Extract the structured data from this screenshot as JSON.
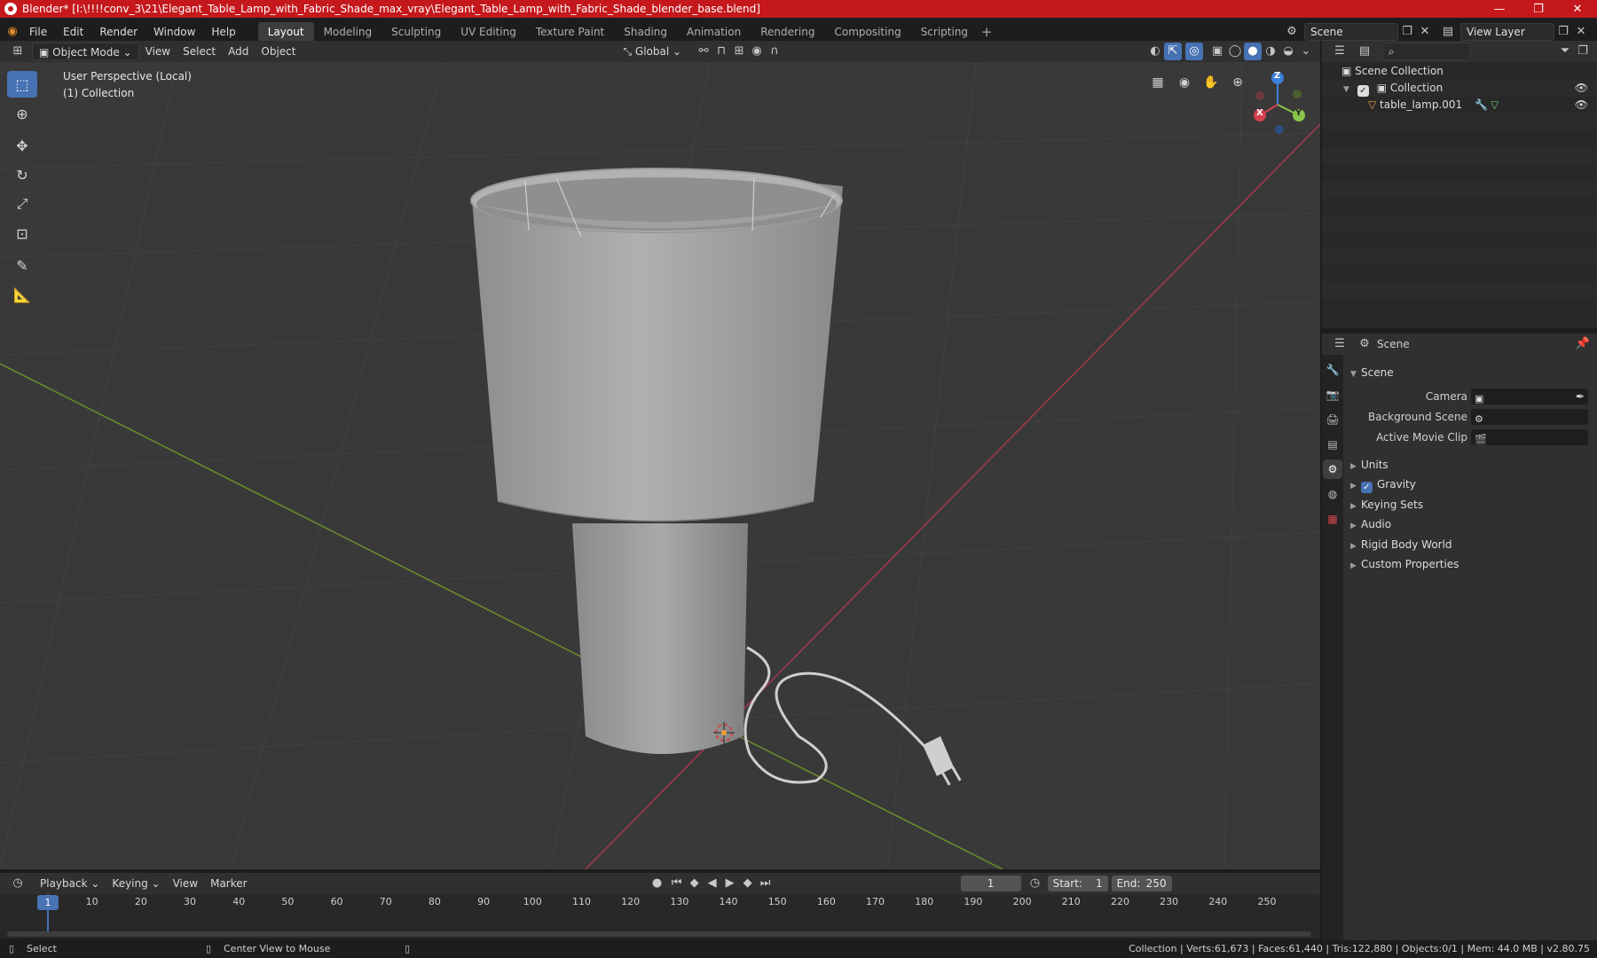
{
  "title": "Blender* [I:\\!!!!conv_3\\21\\Elegant_Table_Lamp_with_Fabric_Shade_max_vray\\Elegant_Table_Lamp_with_Fabric_Shade_blender_base.blend]",
  "window_controls": {
    "minimize": "—",
    "maximize": "❐",
    "close": "✕"
  },
  "menu": {
    "file": "File",
    "edit": "Edit",
    "render": "Render",
    "window": "Window",
    "help": "Help"
  },
  "workspaces": [
    "Layout",
    "Modeling",
    "Sculpting",
    "UV Editing",
    "Texture Paint",
    "Shading",
    "Animation",
    "Rendering",
    "Compositing",
    "Scripting"
  ],
  "active_workspace": "Layout",
  "scene_selector": "Scene",
  "view_layer": "View Layer",
  "viewport_header": {
    "mode": "Object Mode",
    "view": "View",
    "select": "Select",
    "add": "Add",
    "object": "Object",
    "orientation": "Global"
  },
  "viewport_overlay": {
    "perspective": "User Perspective (Local)",
    "collection": "(1) Collection"
  },
  "gizmo": {
    "z": "Z",
    "y": "Y",
    "x": "X"
  },
  "outliner": {
    "root": "Scene Collection",
    "collection": "Collection",
    "object": "table_lamp.001"
  },
  "properties": {
    "header": "Scene",
    "section": "Scene",
    "camera_label": "Camera",
    "background_label": "Background Scene",
    "movieclip_label": "Active Movie Clip",
    "panels": [
      "Units",
      "Gravity",
      "Keying Sets",
      "Audio",
      "Rigid Body World",
      "Custom Properties"
    ]
  },
  "timeline_header": {
    "playback": "Playback",
    "keying": "Keying",
    "view": "View",
    "marker": "Marker",
    "current_frame": "1",
    "start_label": "Start:",
    "start": "1",
    "end_label": "End:",
    "end": "250"
  },
  "timeline_ticks": [
    "1",
    "10",
    "20",
    "30",
    "40",
    "50",
    "60",
    "70",
    "80",
    "90",
    "100",
    "110",
    "120",
    "130",
    "140",
    "150",
    "160",
    "170",
    "180",
    "190",
    "200",
    "210",
    "220",
    "230",
    "240",
    "250"
  ],
  "statusbar": {
    "select": "Select",
    "center_view": "Center View to Mouse",
    "stats": "Collection | Verts:61,673 | Faces:61,440 | Tris:122,880 | Objects:0/1 | Mem: 44.0 MB | v2.80.75"
  },
  "colors": {
    "accent": "#4772b3",
    "titlebar": "#c4181c",
    "x_axis": "#d2404f",
    "y_axis": "#8bc34a",
    "z_axis": "#3d7fd6"
  }
}
